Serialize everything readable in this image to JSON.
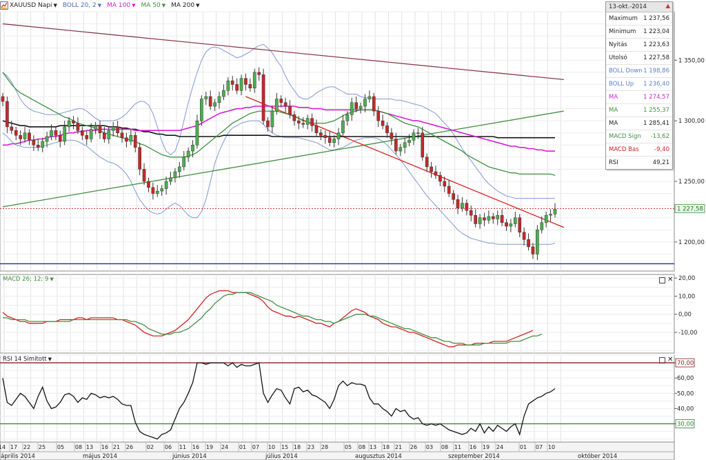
{
  "toolbar": {
    "symbol": "XAUUSD Napi",
    "indicators": [
      {
        "label": "BOLL 20, 2",
        "color": "#4a6ab8"
      },
      {
        "label": "MA 100",
        "color": "#d61bd6"
      },
      {
        "label": "MA 50",
        "color": "#3e8e3e"
      },
      {
        "label": "MA 200",
        "color": "#111111"
      }
    ]
  },
  "info_panel": {
    "date": "13-okt.-2014",
    "rows": [
      {
        "label": "Maximum",
        "value": "1 237,56",
        "color": "#222222"
      },
      {
        "label": "Minimum",
        "value": "1 223,04",
        "color": "#222222"
      },
      {
        "label": "Nyitás",
        "value": "1 223,63",
        "color": "#222222"
      },
      {
        "label": "Utolsó",
        "value": "1 227,58",
        "color": "#222222"
      },
      {
        "label": "BOLL Down",
        "value": "1 198,86",
        "color": "#5b7fc9"
      },
      {
        "label": "BOLL Up",
        "value": "1 236,40",
        "color": "#5b7fc9"
      },
      {
        "label": "MA",
        "value": "1 274,57",
        "color": "#d61bd6"
      },
      {
        "label": "MA",
        "value": "1 255,37",
        "color": "#3e8e3e"
      },
      {
        "label": "MA",
        "value": "1 285,41",
        "color": "#222222"
      },
      {
        "label": "MACD Sign",
        "value": "-13,62",
        "color": "#3e8e3e"
      },
      {
        "label": "MACD Bas",
        "value": "-9,40",
        "color": "#d02020"
      },
      {
        "label": "RSI",
        "value": "49,21",
        "color": "#222222"
      }
    ]
  },
  "panes": {
    "macd_label": "MACD 26; 12; 9",
    "rsi_label": "RSI 14 Simított"
  },
  "chart_data": {
    "type": "candlestick",
    "colors": {
      "up": "#4caf50",
      "down": "#c62828",
      "boll": "#7f97d6",
      "ma100": "#d61bd6",
      "ma50": "#3e8e3e",
      "ma200": "#111111",
      "macd_line": "#d02020",
      "macd_signal": "#3e8e3e",
      "rsi": "#111111",
      "last_price": "#c62828",
      "rsi_levels": "#8b1a1a"
    },
    "price_axis": {
      "ticks": [
        "1 350,00",
        "1 300,00",
        "1 250,00",
        "1 200,00"
      ],
      "values": [
        1350,
        1300,
        1250,
        1200
      ],
      "min": 1176,
      "max": 1390
    },
    "last_price": {
      "value": 1227.58,
      "label": "1 227,58"
    },
    "macd_axis": {
      "ticks": [
        "20,00",
        "10,00",
        "0,00",
        "-10,00"
      ],
      "values": [
        20,
        10,
        0,
        -10
      ],
      "min": -21.5,
      "max": 22
    },
    "rsi_axis": {
      "ticks": [
        "70,00",
        "60,00",
        "50,00",
        "40,00",
        "30,00"
      ],
      "values": [
        70,
        60,
        50,
        40,
        30
      ],
      "min": 18,
      "max": 75
    },
    "rsi_levels": [
      70,
      30
    ],
    "horizontal_line": 1182,
    "date_ticks": [
      "14",
      "17",
      "22",
      "25",
      "05",
      "08",
      "13",
      "16",
      "21",
      "26",
      "02",
      "06",
      "11",
      "16",
      "19",
      "24",
      "01",
      "07",
      "10",
      "15",
      "18",
      "23",
      "28",
      "05",
      "08",
      "13",
      "18",
      "21",
      "26",
      "03",
      "08",
      "11",
      "16",
      "19",
      "24",
      "01",
      "07",
      "10"
    ],
    "months": [
      "április 2014",
      "május 2014",
      "június 2014",
      "július 2014",
      "augusztus 2014",
      "szeptember 2014",
      "október 2014"
    ],
    "trendlines": [
      {
        "color": "#8b3a4a",
        "points": [
          [
            0,
            1380
          ],
          [
            127,
            1334
          ]
        ]
      },
      {
        "color": "#3e8e3e",
        "points": [
          [
            0,
            1229
          ],
          [
            127,
            1308
          ]
        ]
      },
      {
        "color": "#d62020",
        "points": [
          [
            55,
            1320
          ],
          [
            127,
            1212
          ]
        ]
      }
    ],
    "close": [
      1316,
      1295,
      1292,
      1288,
      1285,
      1290,
      1284,
      1280,
      1278,
      1283,
      1287,
      1292,
      1288,
      1283,
      1295,
      1300,
      1298,
      1292,
      1288,
      1285,
      1293,
      1296,
      1290,
      1285,
      1292,
      1295,
      1290,
      1286,
      1283,
      1288,
      1278,
      1260,
      1250,
      1245,
      1240,
      1242,
      1244,
      1250,
      1253,
      1258,
      1262,
      1270,
      1275,
      1280,
      1300,
      1318,
      1320,
      1312,
      1315,
      1320,
      1325,
      1333,
      1330,
      1325,
      1335,
      1330,
      1327,
      1340,
      1338,
      1300,
      1295,
      1308,
      1318,
      1315,
      1312,
      1305,
      1300,
      1298,
      1297,
      1302,
      1296,
      1290,
      1288,
      1286,
      1282,
      1285,
      1290,
      1300,
      1305,
      1315,
      1310,
      1312,
      1318,
      1320,
      1308,
      1300,
      1296,
      1290,
      1285,
      1275,
      1278,
      1282,
      1284,
      1290,
      1290,
      1270,
      1262,
      1258,
      1255,
      1250,
      1246,
      1240,
      1235,
      1228,
      1232,
      1226,
      1222,
      1215,
      1220,
      1218,
      1221,
      1219,
      1222,
      1216,
      1213,
      1215,
      1220,
      1208,
      1202,
      1196,
      1190,
      1210,
      1216,
      1222,
      1223,
      1227
    ],
    "macd": [
      1,
      -1,
      -2,
      -3,
      -4,
      -4,
      -5,
      -5,
      -5,
      -5,
      -4,
      -4,
      -4,
      -3,
      -3,
      -3,
      -3,
      -2,
      -2,
      -3,
      -2,
      -2,
      -2,
      -2,
      -2,
      -2,
      -3,
      -3,
      -4,
      -5,
      -6,
      -8,
      -10,
      -11,
      -12,
      -12,
      -12,
      -11,
      -10,
      -9,
      -7,
      -5,
      -3,
      0,
      3,
      6,
      9,
      11,
      12,
      13,
      13,
      13,
      12,
      12,
      12,
      12,
      11,
      10,
      9,
      7,
      4,
      2,
      1,
      0,
      -1,
      -1,
      -2,
      -1,
      -2,
      -3,
      -4,
      -5,
      -5,
      -6,
      -7,
      -5,
      -4,
      -2,
      0,
      2,
      3,
      2,
      1,
      -1,
      -2,
      -3,
      -5,
      -6,
      -7,
      -7,
      -8,
      -9,
      -10,
      -10,
      -11,
      -12,
      -13,
      -14,
      -15,
      -16,
      -17,
      -18,
      -18,
      -17,
      -17,
      -17,
      -17,
      -16,
      -16,
      -16,
      -16,
      -15,
      -15,
      -15,
      -15,
      -14,
      -13,
      -12,
      -11,
      -10,
      -9
    ],
    "macd_signal": [
      -2,
      -2,
      -3,
      -3,
      -3,
      -3,
      -4,
      -4,
      -4,
      -4,
      -4,
      -4,
      -4,
      -4,
      -4,
      -4,
      -3,
      -3,
      -3,
      -3,
      -3,
      -3,
      -3,
      -3,
      -3,
      -3,
      -3,
      -3,
      -3,
      -4,
      -4,
      -5,
      -6,
      -8,
      -9,
      -10,
      -11,
      -11,
      -11,
      -10,
      -10,
      -9,
      -8,
      -6,
      -4,
      -2,
      1,
      3,
      6,
      8,
      10,
      11,
      11,
      12,
      12,
      12,
      12,
      11,
      10,
      9,
      8,
      7,
      5,
      4,
      3,
      2,
      1,
      0,
      -1,
      -1,
      -2,
      -3,
      -3,
      -4,
      -4,
      -5,
      -4,
      -3,
      -2,
      -1,
      0,
      0,
      0,
      -1,
      -1,
      -2,
      -3,
      -4,
      -5,
      -6,
      -7,
      -8,
      -8,
      -9,
      -10,
      -11,
      -12,
      -13,
      -13,
      -14,
      -15,
      -15,
      -16,
      -16,
      -16,
      -17,
      -17,
      -17,
      -17,
      -16,
      -16,
      -16,
      -16,
      -16,
      -16,
      -15,
      -15,
      -15,
      -14,
      -13,
      -12,
      -12,
      -11
    ],
    "rsi": [
      60,
      44,
      42,
      46,
      50,
      48,
      44,
      40,
      48,
      54,
      45,
      40,
      41,
      44,
      49,
      50,
      48,
      44,
      47,
      46,
      50,
      49,
      47,
      48,
      47,
      48,
      46,
      43,
      42,
      42,
      31,
      25,
      23,
      22,
      21,
      20,
      23,
      24,
      26,
      33,
      40,
      44,
      50,
      57,
      70,
      70,
      69,
      70,
      70,
      70,
      70,
      68,
      70,
      67,
      69,
      68,
      68,
      69,
      70,
      50,
      44,
      49,
      53,
      52,
      47,
      43,
      53,
      54,
      51,
      52,
      49,
      48,
      46,
      44,
      40,
      46,
      55,
      58,
      55,
      57,
      56,
      56,
      55,
      47,
      43,
      43,
      40,
      38,
      35,
      40,
      38,
      39,
      35,
      33,
      34,
      30,
      29,
      30,
      29,
      30,
      28,
      26,
      25,
      24,
      23,
      24,
      27,
      25,
      30,
      24,
      28,
      25,
      29,
      27,
      25,
      28,
      30,
      23,
      35,
      43,
      45,
      47,
      48,
      50,
      51,
      53
    ],
    "ma200": [
      1300,
      1299,
      1298,
      1297,
      1296,
      1296,
      1295,
      1295,
      1295,
      1295,
      1295,
      1295,
      1295,
      1296,
      1296,
      1296,
      1296,
      1296,
      1296,
      1296,
      1296,
      1296,
      1296,
      1296,
      1295,
      1295,
      1295,
      1294,
      1294,
      1293,
      1293,
      1292,
      1291,
      1291,
      1290,
      1289,
      1289,
      1288,
      1288,
      1288,
      1287,
      1287,
      1287,
      1287,
      1287,
      1287,
      1287,
      1287,
      1287,
      1287,
      1288,
      1288,
      1288,
      1288,
      1288,
      1288,
      1288,
      1288,
      1288,
      1288,
      1288,
      1287,
      1287,
      1287,
      1287,
      1287,
      1287,
      1287,
      1287,
      1287,
      1287,
      1287,
      1287,
      1287,
      1287,
      1287,
      1287,
      1287,
      1287,
      1287,
      1287,
      1287,
      1287,
      1287,
      1287,
      1287,
      1287,
      1287,
      1287,
      1287,
      1287,
      1287,
      1287,
      1287,
      1287,
      1287,
      1287,
      1287,
      1287,
      1287,
      1287,
      1287,
      1287,
      1287,
      1287,
      1287,
      1287,
      1287,
      1287,
      1287,
      1287,
      1287,
      1286,
      1286,
      1286,
      1286,
      1286,
      1286,
      1286,
      1286,
      1286,
      1286,
      1286,
      1286,
      1286,
      1286
    ],
    "ma100": [
      1280,
      1280,
      1281,
      1281,
      1282,
      1283,
      1284,
      1284,
      1285,
      1285,
      1286,
      1287,
      1287,
      1288,
      1289,
      1290,
      1290,
      1291,
      1291,
      1292,
      1292,
      1292,
      1293,
      1293,
      1293,
      1293,
      1293,
      1293,
      1293,
      1293,
      1292,
      1292,
      1292,
      1292,
      1292,
      1292,
      1292,
      1292,
      1292,
      1292,
      1292,
      1293,
      1294,
      1295,
      1296,
      1298,
      1300,
      1302,
      1304,
      1306,
      1307,
      1308,
      1309,
      1310,
      1310,
      1311,
      1311,
      1312,
      1312,
      1312,
      1312,
      1312,
      1312,
      1312,
      1312,
      1312,
      1312,
      1311,
      1311,
      1311,
      1310,
      1310,
      1310,
      1309,
      1309,
      1309,
      1309,
      1309,
      1309,
      1309,
      1309,
      1309,
      1309,
      1309,
      1309,
      1308,
      1307,
      1306,
      1305,
      1304,
      1303,
      1302,
      1301,
      1300,
      1300,
      1299,
      1298,
      1297,
      1296,
      1295,
      1294,
      1293,
      1292,
      1291,
      1290,
      1289,
      1288,
      1287,
      1286,
      1285,
      1284,
      1283,
      1282,
      1281,
      1280,
      1279,
      1279,
      1278,
      1278,
      1277,
      1277,
      1276,
      1276,
      1275,
      1275,
      1275
    ],
    "ma50": [
      1340,
      1335,
      1330,
      1326,
      1323,
      1321,
      1319,
      1317,
      1315,
      1313,
      1311,
      1309,
      1307,
      1305,
      1303,
      1302,
      1300,
      1298,
      1297,
      1296,
      1295,
      1294,
      1292,
      1290,
      1289,
      1288,
      1287,
      1286,
      1285,
      1284,
      1283,
      1281,
      1280,
      1278,
      1276,
      1274,
      1272,
      1271,
      1270,
      1270,
      1270,
      1270,
      1271,
      1272,
      1274,
      1277,
      1280,
      1283,
      1286,
      1289,
      1292,
      1295,
      1298,
      1300,
      1302,
      1304,
      1306,
      1307,
      1308,
      1308,
      1308,
      1308,
      1308,
      1307,
      1306,
      1305,
      1304,
      1302,
      1300,
      1299,
      1298,
      1298,
      1298,
      1298,
      1299,
      1300,
      1302,
      1304,
      1306,
      1307,
      1308,
      1309,
      1309,
      1309,
      1309,
      1308,
      1307,
      1306,
      1304,
      1302,
      1300,
      1298,
      1297,
      1296,
      1295,
      1293,
      1291,
      1289,
      1287,
      1285,
      1283,
      1281,
      1279,
      1277,
      1275,
      1272,
      1270,
      1268,
      1266,
      1264,
      1262,
      1261,
      1260,
      1259,
      1258,
      1257,
      1257,
      1256,
      1256,
      1256,
      1256,
      1256,
      1256,
      1256,
      1256,
      1255
    ],
    "boll_up": [
      1340,
      1337,
      1332,
      1325,
      1318,
      1313,
      1310,
      1308,
      1307,
      1306,
      1305,
      1305,
      1305,
      1306,
      1307,
      1308,
      1309,
      1310,
      1310,
      1308,
      1305,
      1302,
      1300,
      1300,
      1300,
      1300,
      1301,
      1303,
      1306,
      1310,
      1314,
      1316,
      1316,
      1313,
      1306,
      1295,
      1283,
      1275,
      1272,
      1275,
      1285,
      1300,
      1315,
      1328,
      1340,
      1350,
      1357,
      1360,
      1361,
      1360,
      1358,
      1356,
      1354,
      1352,
      1353,
      1355,
      1357,
      1360,
      1362,
      1363,
      1360,
      1356,
      1350,
      1345,
      1337,
      1330,
      1325,
      1320,
      1318,
      1318,
      1320,
      1323,
      1325,
      1327,
      1328,
      1328,
      1326,
      1324,
      1322,
      1322,
      1322,
      1320,
      1319,
      1319,
      1318,
      1318,
      1318,
      1318,
      1318,
      1317,
      1317,
      1316,
      1315,
      1314,
      1313,
      1312,
      1310,
      1308,
      1306,
      1302,
      1298,
      1294,
      1289,
      1283,
      1277,
      1272,
      1267,
      1262,
      1257,
      1252,
      1248,
      1245,
      1242,
      1240,
      1238,
      1237,
      1236,
      1236,
      1236,
      1236,
      1236,
      1236,
      1236,
      1236,
      1236,
      1236
    ],
    "boll_down": [
      1290,
      1287,
      1283,
      1280,
      1279,
      1278,
      1278,
      1278,
      1278,
      1279,
      1280,
      1281,
      1282,
      1283,
      1284,
      1284,
      1284,
      1283,
      1281,
      1279,
      1276,
      1273,
      1270,
      1268,
      1266,
      1265,
      1263,
      1260,
      1256,
      1250,
      1242,
      1235,
      1230,
      1226,
      1224,
      1223,
      1224,
      1227,
      1230,
      1232,
      1230,
      1226,
      1222,
      1220,
      1220,
      1225,
      1235,
      1250,
      1265,
      1275,
      1283,
      1290,
      1294,
      1296,
      1298,
      1299,
      1300,
      1300,
      1300,
      1297,
      1293,
      1290,
      1288,
      1287,
      1286,
      1286,
      1286,
      1286,
      1285,
      1284,
      1283,
      1282,
      1280,
      1278,
      1276,
      1276,
      1277,
      1278,
      1280,
      1282,
      1284,
      1285,
      1286,
      1286,
      1286,
      1285,
      1283,
      1280,
      1276,
      1272,
      1268,
      1263,
      1258,
      1253,
      1248,
      1243,
      1238,
      1234,
      1230,
      1226,
      1222,
      1218,
      1214,
      1210,
      1207,
      1205,
      1203,
      1202,
      1201,
      1200,
      1199,
      1199,
      1198,
      1198,
      1198,
      1198,
      1198,
      1198,
      1198,
      1198,
      1198,
      1198,
      1198,
      1198,
      1198,
      1199
    ]
  }
}
